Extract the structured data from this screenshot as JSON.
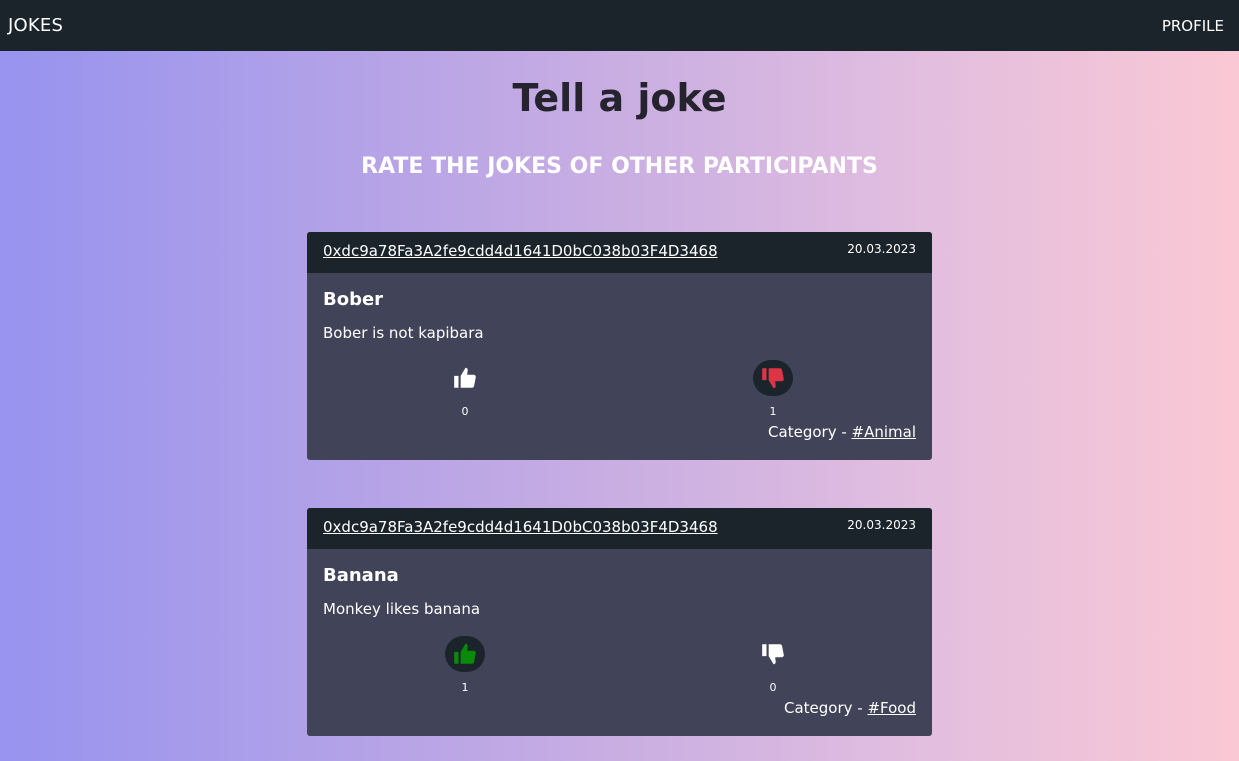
{
  "nav": {
    "brand": "JOKES",
    "profile": "PROFILE"
  },
  "page": {
    "title": "Tell a joke",
    "subtitle": "RATE THE JOKES OF OTHER PARTICIPANTS"
  },
  "colors": {
    "like_active": "#0a8a0a",
    "dislike_active": "#dc3545",
    "icon_inactive": "#ffffff"
  },
  "jokes": [
    {
      "author": "0xdc9a78Fa3A2fe9cdd4d1641D0bC038b03F4D3468",
      "date": "20.03.2023",
      "title": "Bober",
      "text": "Bober is not kapibara",
      "likes": "0",
      "dislikes": "1",
      "liked": false,
      "disliked": true,
      "category_prefix": "Category - ",
      "category": "#Animal"
    },
    {
      "author": "0xdc9a78Fa3A2fe9cdd4d1641D0bC038b03F4D3468",
      "date": "20.03.2023",
      "title": "Banana",
      "text": "Monkey likes banana",
      "likes": "1",
      "dislikes": "0",
      "liked": true,
      "disliked": false,
      "category_prefix": "Category - ",
      "category": "#Food"
    }
  ]
}
